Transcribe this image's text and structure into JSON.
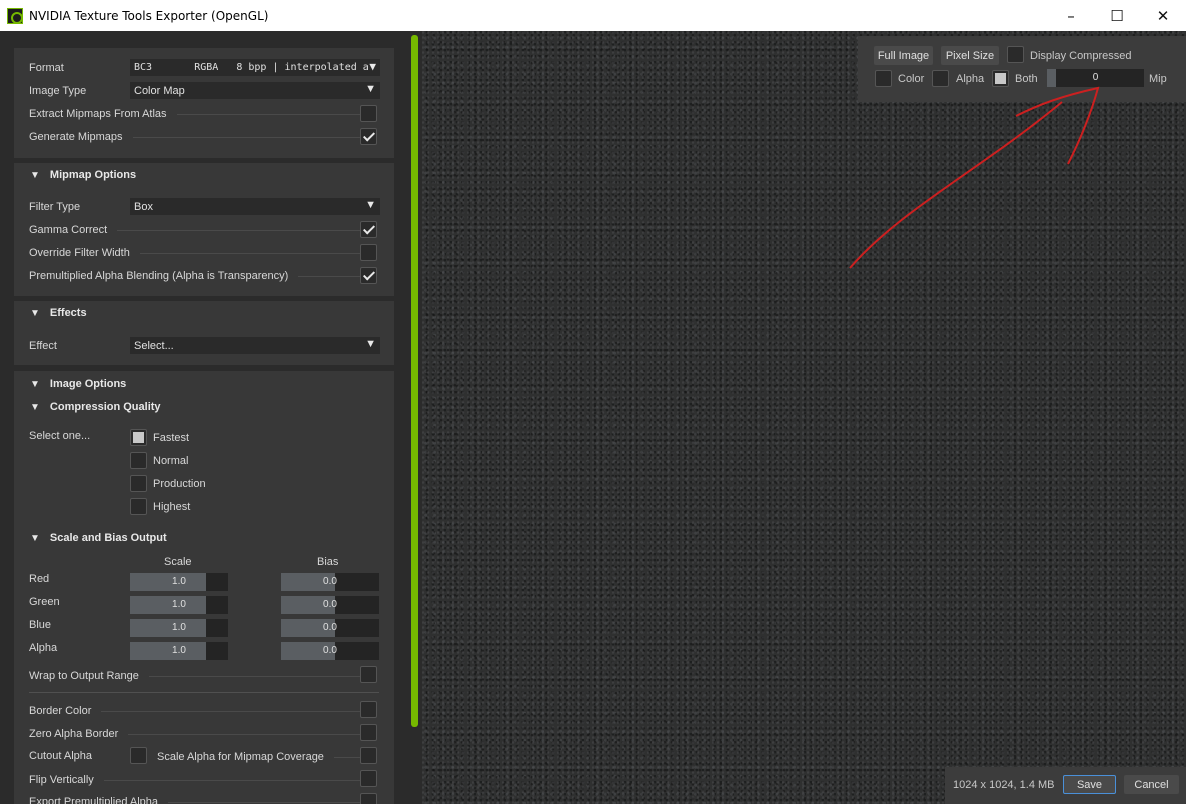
{
  "window": {
    "title": "NVIDIA Texture Tools Exporter (OpenGL)",
    "minimize": "–",
    "maximize": "☐",
    "close": "✕"
  },
  "general": {
    "format_label": "Format",
    "format_value": "BC3       RGBA   8 bpp | interpolated a",
    "image_type_label": "Image Type",
    "image_type_value": "Color Map",
    "extract_mipmaps_label": "Extract Mipmaps From Atlas",
    "extract_mipmaps_checked": false,
    "generate_mipmaps_label": "Generate Mipmaps",
    "generate_mipmaps_checked": true
  },
  "mipmap_options": {
    "header": "Mipmap Options",
    "filter_type_label": "Filter Type",
    "filter_type_value": "Box",
    "gamma_correct_label": "Gamma Correct",
    "gamma_correct_checked": true,
    "override_filter_width_label": "Override Filter Width",
    "override_filter_width_checked": false,
    "premultiplied_label": "Premultiplied Alpha Blending (Alpha is Transparency)",
    "premultiplied_checked": true
  },
  "effects": {
    "header": "Effects",
    "effect_label": "Effect",
    "effect_value": "Select..."
  },
  "image_options": {
    "header": "Image Options",
    "compression_header": "Compression Quality",
    "select_one_label": "Select one...",
    "options": [
      {
        "label": "Fastest",
        "selected": true
      },
      {
        "label": "Normal",
        "selected": false
      },
      {
        "label": "Production",
        "selected": false
      },
      {
        "label": "Highest",
        "selected": false
      }
    ],
    "scale_bias_header": "Scale and Bias Output",
    "scale_col": "Scale",
    "bias_col": "Bias",
    "channels": [
      {
        "label": "Red",
        "scale": "1.0",
        "bias": "0.0"
      },
      {
        "label": "Green",
        "scale": "1.0",
        "bias": "0.0"
      },
      {
        "label": "Blue",
        "scale": "1.0",
        "bias": "0.0"
      },
      {
        "label": "Alpha",
        "scale": "1.0",
        "bias": "0.0"
      }
    ],
    "wrap_label": "Wrap to Output Range",
    "border_color_label": "Border Color",
    "zero_alpha_label": "Zero Alpha Border",
    "cutout_alpha_label": "Cutout Alpha",
    "scale_alpha_label": "Scale Alpha for Mipmap Coverage",
    "flip_label": "Flip Vertically",
    "export_premult_label": "Export Premultiplied Alpha"
  },
  "preview": {
    "full_image_btn": "Full Image",
    "pixel_size_btn": "Pixel Size",
    "display_compressed_label": "Display Compressed",
    "color_label": "Color",
    "alpha_label": "Alpha",
    "both_label": "Both",
    "mip_value": "0",
    "mip_label": "Mip",
    "status": "1024 x 1024, 1.4 MB",
    "save_btn": "Save",
    "cancel_btn": "Cancel",
    "accent_color": "#76b900",
    "annotation_color": "#cc2020"
  }
}
